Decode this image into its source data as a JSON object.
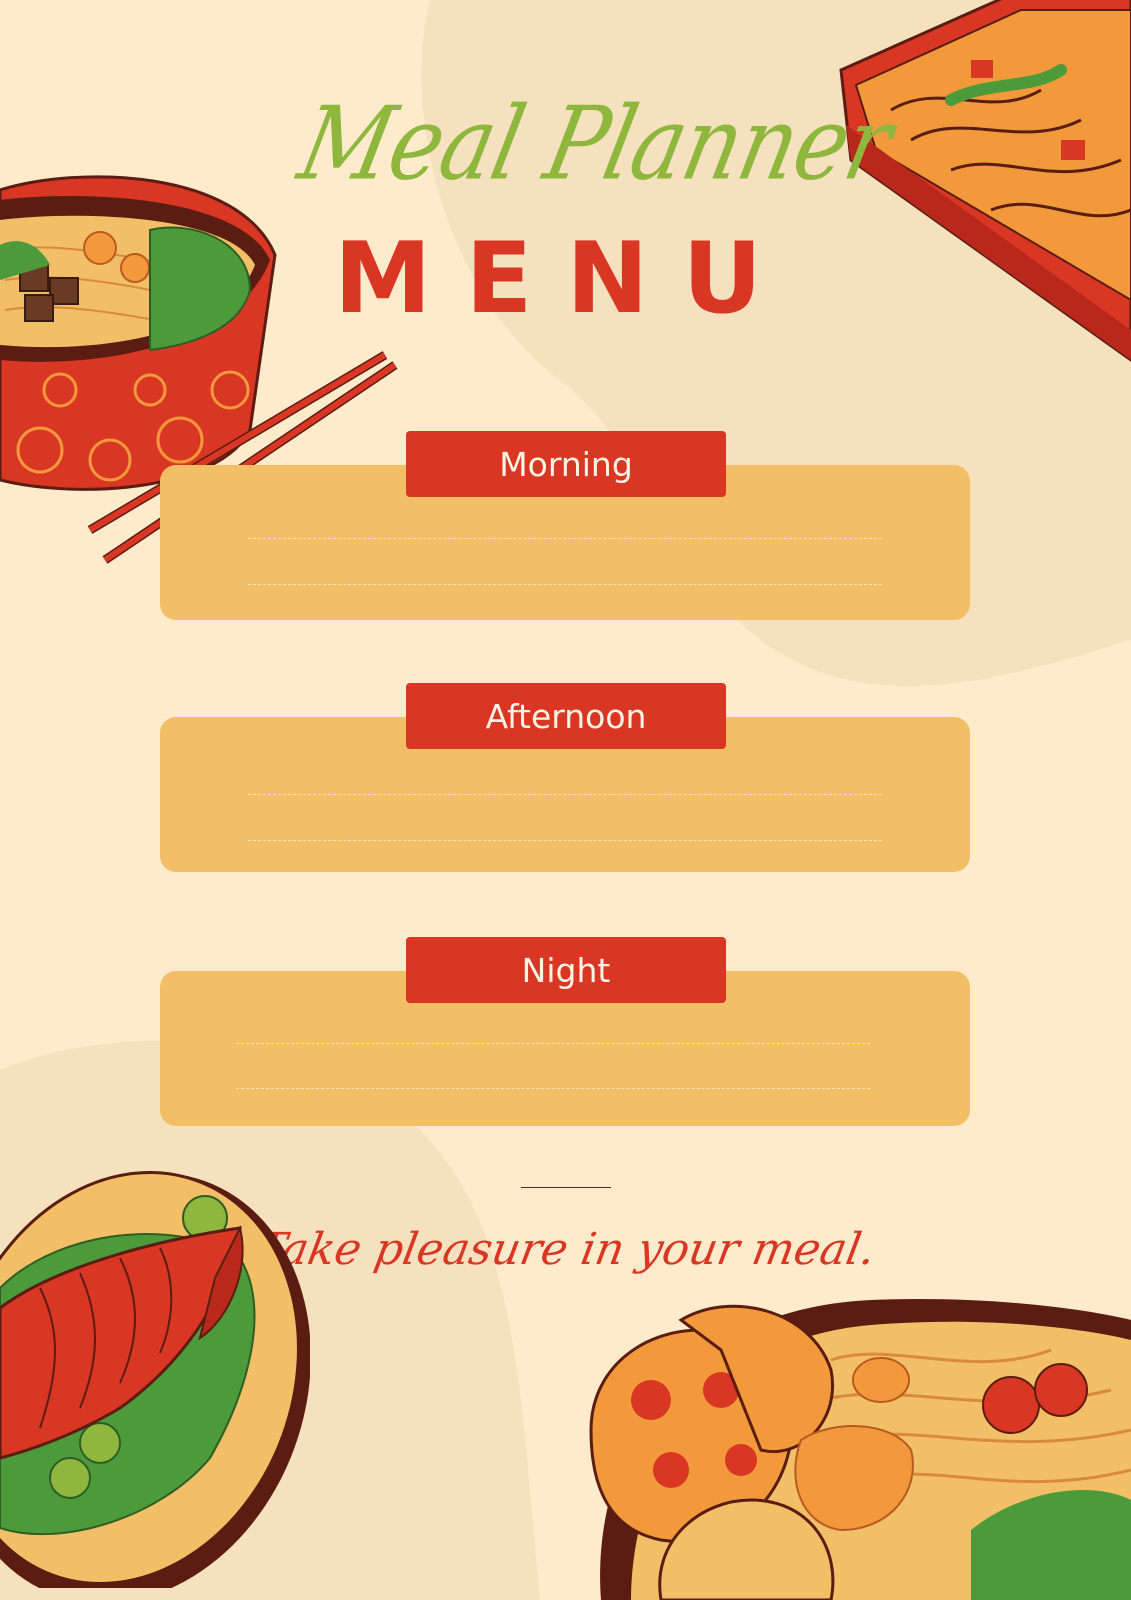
{
  "header": {
    "script_title": "Meal Planner",
    "main_title": "MENU"
  },
  "sections": [
    {
      "label": "Morning"
    },
    {
      "label": "Afternoon"
    },
    {
      "label": "Night"
    }
  ],
  "footer": {
    "tagline": "Take pleasure in your meal."
  },
  "colors": {
    "background": "#fdebcb",
    "panel": "#f2bf67",
    "accent_red": "#d93623",
    "script_green": "#8fb73e"
  },
  "illustrations": [
    "ramen-bowl-icon",
    "chopsticks-icon",
    "noodle-box-icon",
    "grilled-fish-plate-icon",
    "rice-bowl-icon"
  ]
}
